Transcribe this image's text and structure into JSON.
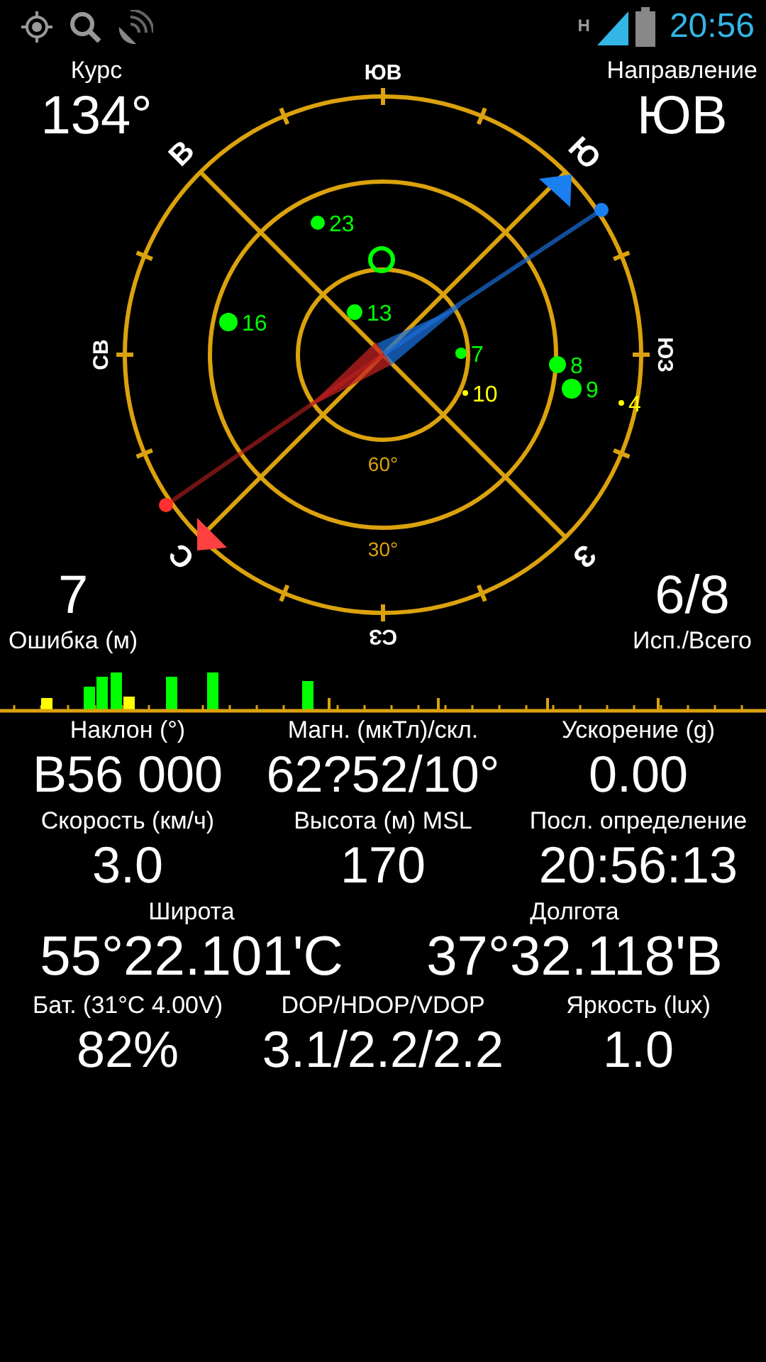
{
  "status_bar": {
    "network": "H",
    "time": "20:56"
  },
  "course": {
    "label": "Курс",
    "value": "134°"
  },
  "direction": {
    "label": "Направление",
    "value": "ЮВ"
  },
  "error": {
    "value": "7",
    "label": "Ошибка (м)"
  },
  "satellite_count": {
    "value": "6/8",
    "label": "Исп./Всего"
  },
  "compass": {
    "labels": [
      "ЮВ",
      "Ю",
      "ЮЗ",
      "З",
      "СЗ",
      "С",
      "СВ",
      "В"
    ],
    "rings": [
      "60°",
      "30°"
    ]
  },
  "satellites": [
    {
      "number": "23",
      "used": true
    },
    {
      "number": "13",
      "used": true
    },
    {
      "number": "16",
      "used": true
    },
    {
      "number": "7",
      "used": true
    },
    {
      "number": "8",
      "used": true
    },
    {
      "number": "9",
      "used": true
    },
    {
      "number": "10",
      "used": false
    },
    {
      "number": "4",
      "used": false
    }
  ],
  "readings": [
    {
      "label": "Наклон (°)",
      "value": "В56 000"
    },
    {
      "label": "Магн. (мкТл)/скл.",
      "value": "62?52/10°"
    },
    {
      "label": "Ускорение (g)",
      "value": "0.00"
    },
    {
      "label": "Скорость (км/ч)",
      "value": "3.0"
    },
    {
      "label": "Высота (м) MSL",
      "value": "170"
    },
    {
      "label": "Посл. определение",
      "value": "20:56:13"
    }
  ],
  "position": [
    {
      "label": "Широта",
      "value": "55°22.101'С"
    },
    {
      "label": "Долгота",
      "value": "37°32.118'В"
    }
  ],
  "readings_bottom": [
    {
      "label": "Бат. (31°C 4.00V)",
      "value": "82%"
    },
    {
      "label": "DOP/HDOP/VDOP",
      "value": "3.1/2.2/2.2"
    },
    {
      "label": "Яркость (lux)",
      "value": "1.0"
    }
  ]
}
